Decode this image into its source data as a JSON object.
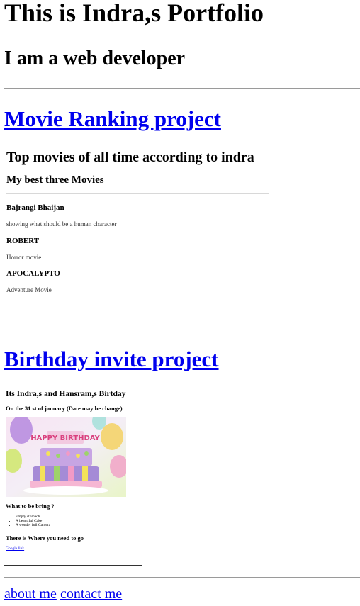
{
  "header": {
    "title": "This is Indra,s Portfolio",
    "subtitle": "I am a web developer"
  },
  "projects": {
    "movie_link": "Movie Ranking project",
    "birthday_link": "Birthday invite project"
  },
  "movie_preview": {
    "title": "Top movies of all time according to indra",
    "subtitle": "My best three Movies",
    "movies": [
      {
        "name": "Bajrangi Bhaijan",
        "desc": "showing what should be a human character"
      },
      {
        "name": "ROBERT",
        "desc": "Horror movie"
      },
      {
        "name": "APOCALYPTO",
        "desc": "Adventure Movie"
      }
    ]
  },
  "birthday_preview": {
    "title": "Its Indra,s and Hansram,s Birtday",
    "date": "On the 31 st of january (Date may be change)",
    "cake_text": "HAPPY BIRTHDAY",
    "bring_heading": "What to be bring ?",
    "items": [
      "Empty stomach",
      "A beautiful Cake",
      "A wonder full Camera"
    ],
    "where_heading": "There is Where you need to go",
    "map_link": "Google link"
  },
  "footer": {
    "about": "about me",
    "contact": "contact me"
  },
  "colors": {
    "link": "#0000ee",
    "rule": "#9a9a9a"
  }
}
